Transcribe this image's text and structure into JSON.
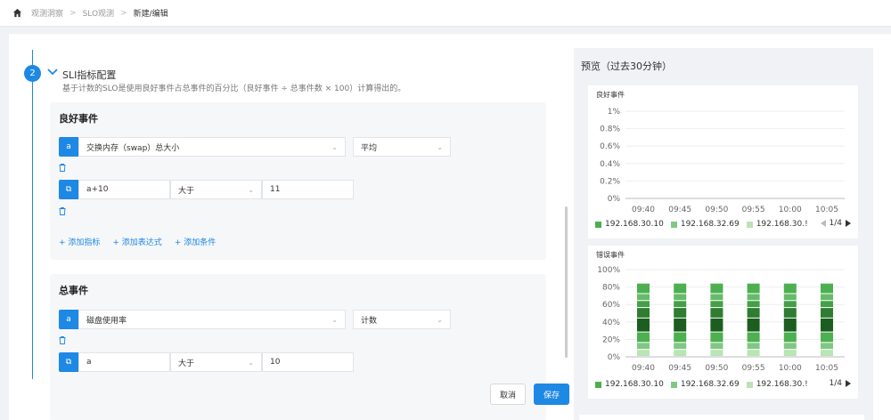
{
  "breadcrumb": {
    "items": [
      "观测洞察",
      "SLO观测"
    ],
    "current": "新建/编辑",
    "separator": ">"
  },
  "section": {
    "step": "2",
    "title": "SLI指标配置",
    "description": "基于计数的SLO是使用良好事件占总事件的百分比（良好事件 ÷ 总事件数 × 100）计算得出的。"
  },
  "good_events": {
    "title": "良好事件",
    "metric_tag": "a",
    "metric": "交换内存（swap）总大小",
    "aggregation": "平均",
    "expr_tag": "⧉",
    "expression": "a+10",
    "operator": "大于",
    "threshold": "11",
    "links": {
      "add_metric": "+ 添加指标",
      "add_expression": "+ 添加表达式",
      "add_condition": "+ 添加条件"
    }
  },
  "total_events": {
    "title": "总事件",
    "metric_tag": "a",
    "metric": "磁盘使用率",
    "aggregation": "计数",
    "expr_tag": "⧉",
    "expression": "a",
    "operator": "大于",
    "threshold": "10"
  },
  "buttons": {
    "cancel": "取消",
    "save": "保存"
  },
  "preview": {
    "title": "预览（过去30分钟）"
  },
  "colors": {
    "accent": "#1e88e5",
    "series": [
      "#4caf50",
      "#81c784",
      "#b9e4b4"
    ],
    "dark_series": [
      "#1b5e20",
      "#2e7d32",
      "#43a047"
    ]
  },
  "icons": {
    "home": "home-icon",
    "trash": "trash-icon",
    "chevron": "chevron-down-icon"
  },
  "chart_data": [
    {
      "type": "line",
      "title": "良好事件",
      "x": [
        "09:40",
        "09:45",
        "09:50",
        "09:55",
        "10:00",
        "10:05"
      ],
      "ytick_labels": [
        "0%",
        "0.2%",
        "0.4%",
        "0.6%",
        "0.8%",
        "1%"
      ],
      "ylim": [
        0,
        1
      ],
      "grid": true,
      "legend_position": "bottom",
      "legend": [
        "192.168.30.10",
        "192.168.32.69",
        "192.168.30.!"
      ],
      "pager": "1/4",
      "series": [
        {
          "name": "192.168.30.10",
          "values": []
        },
        {
          "name": "192.168.32.69",
          "values": []
        },
        {
          "name": "192.168.30.!",
          "values": []
        }
      ]
    },
    {
      "type": "bar",
      "stacked": true,
      "title": "错误事件",
      "categories": [
        "09:40",
        "09:45",
        "09:50",
        "09:55",
        "10:00",
        "10:05"
      ],
      "ytick_labels": [
        "0%",
        "20%",
        "40%",
        "60%",
        "80%",
        "100%"
      ],
      "ylim": [
        0,
        100
      ],
      "grid": true,
      "legend_position": "bottom",
      "legend": [
        "192.168.30.10",
        "192.168.32.69",
        "192.168.30.!"
      ],
      "pager": "1/4",
      "segments_per_bar": [
        8,
        8,
        12,
        16,
        12,
        8,
        8,
        12
      ]
    }
  ]
}
